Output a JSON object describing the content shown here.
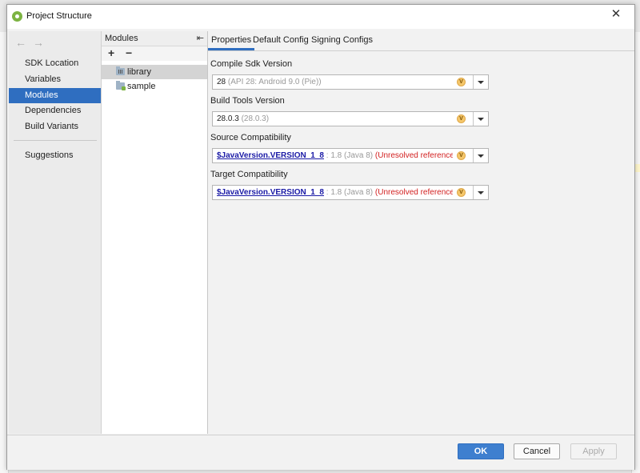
{
  "window": {
    "title": "Project Structure",
    "close_glyph": "✕"
  },
  "nav": {
    "back_glyph": "←",
    "forward_glyph": "→",
    "items": [
      {
        "label": "SDK Location"
      },
      {
        "label": "Variables"
      },
      {
        "label": "Modules",
        "selected": true
      },
      {
        "label": "Dependencies"
      },
      {
        "label": "Build Variants"
      },
      {
        "label": "Suggestions"
      }
    ]
  },
  "modules": {
    "title": "Modules",
    "collapse_glyph": "⇤",
    "add_glyph": "+",
    "remove_glyph": "−",
    "items": [
      {
        "label": "library",
        "icon": "library-module-icon",
        "selected": true
      },
      {
        "label": "sample",
        "icon": "app-module-icon"
      }
    ]
  },
  "tabs": [
    {
      "label": "Properties",
      "selected": true
    },
    {
      "label": "Default Config"
    },
    {
      "label": "Signing Configs"
    }
  ],
  "fields": {
    "compile_sdk": {
      "label": "Compile Sdk Version",
      "value": "28",
      "hint": "(API 28: Android 9.0 (Pie))"
    },
    "build_tools": {
      "label": "Build Tools Version",
      "value": "28.0.3",
      "hint": "(28.0.3)"
    },
    "source_compat": {
      "label": "Source Compatibility",
      "value": "$JavaVersion.VERSION_1_8",
      "hint": ": 1.8 (Java 8)",
      "error": "(Unresolved reference: Ja"
    },
    "target_compat": {
      "label": "Target Compatibility",
      "value": "$JavaVersion.VERSION_1_8",
      "hint": ": 1.8 (Java 8)",
      "error": "(Unresolved reference: Ja"
    },
    "variable_badge": "V"
  },
  "footer": {
    "ok": "OK",
    "cancel": "Cancel",
    "apply": "Apply"
  },
  "colors": {
    "accent": "#2f6ec0",
    "error": "#d21f1f",
    "link": "#1a1aa6"
  }
}
